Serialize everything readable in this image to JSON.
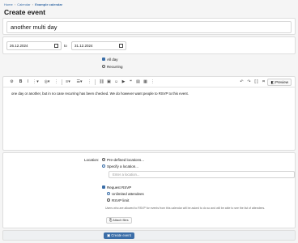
{
  "breadcrumb": {
    "items": [
      "Home",
      "Calendar",
      "Example calendar"
    ]
  },
  "page": {
    "title": "Create event"
  },
  "event": {
    "title_value": "another multi day"
  },
  "dates": {
    "start": "26.12.2024",
    "to_label": "to",
    "end": "31.12.2024"
  },
  "options": {
    "all_day": "All day",
    "recurring": "Recurring"
  },
  "editor": {
    "preview_label": "Preview",
    "body_text": "one day or another, but in no case recurring has been checked. We do however want people to RSVP to this event."
  },
  "location": {
    "label": "Location:",
    "predefined": "Pre-defined locations...",
    "specify": "Specify a location...",
    "input_placeholder": "Enter a location..."
  },
  "rsvp": {
    "request_label": "Request RSVP",
    "unlimited": "Unlimited attendees",
    "limit": "RSVP limit",
    "hint": "Users who are allowed to RSVP for events from this calendar will be asked to do so and will be able to see the list of attendees."
  },
  "attach_label": "Attach files",
  "footer": {
    "create_label": "Create event"
  },
  "colors": {
    "accent": "#3b6ea8"
  }
}
